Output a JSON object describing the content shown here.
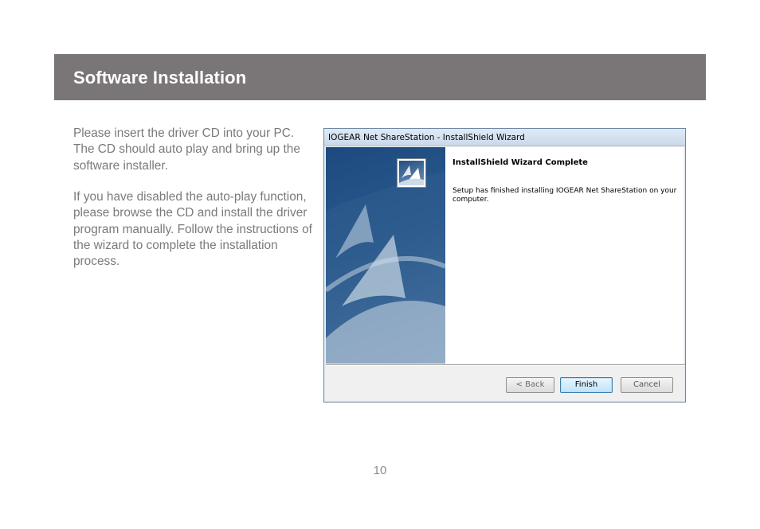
{
  "header": {
    "title": "Software Installation"
  },
  "body": {
    "paragraph1": "Please insert the driver CD into your PC. The CD should auto play and bring up the software installer.",
    "paragraph2": "If you have disabled the auto-play function, please browse the CD and install the driver program manually. Follow the instructions of the wizard to complete the installation process."
  },
  "dialog": {
    "window_title": "IOGEAR Net ShareStation - InstallShield Wizard",
    "heading": "InstallShield Wizard Complete",
    "message": "Setup has finished installing IOGEAR Net ShareStation on your computer.",
    "buttons": {
      "back": "< Back",
      "finish": "Finish",
      "cancel": "Cancel"
    }
  },
  "footer": {
    "page_number": "10"
  }
}
